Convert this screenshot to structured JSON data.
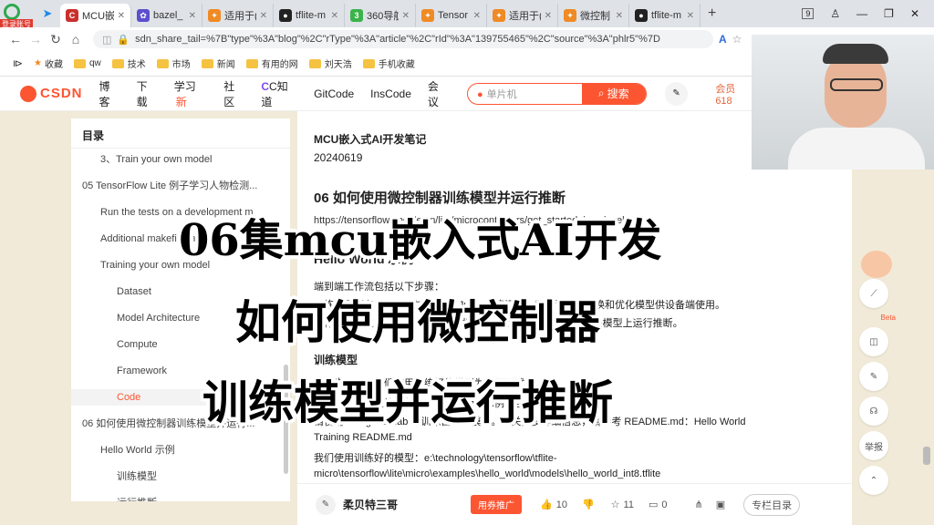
{
  "badge": "登录账号",
  "tabs": [
    {
      "label": "MCU嵌",
      "color": "#c9302c",
      "icon": "C",
      "active": true
    },
    {
      "label": "bazel_",
      "color": "#5b4fcf",
      "icon": "✿"
    },
    {
      "label": "适用于(",
      "color": "#f08a24",
      "icon": "✦"
    },
    {
      "label": "tflite-m",
      "color": "#222222",
      "icon": "●"
    },
    {
      "label": "360导航",
      "color": "#3bb34a",
      "icon": "3"
    },
    {
      "label": "Tensor",
      "color": "#f08a24",
      "icon": "✦"
    },
    {
      "label": "适用于(",
      "color": "#f08a24",
      "icon": "✦"
    },
    {
      "label": "微控制",
      "color": "#f08a24",
      "icon": "✦"
    },
    {
      "label": "tflite-m",
      "color": "#222222",
      "icon": "●"
    }
  ],
  "address": {
    "url": "sdn_share_tail=%7B\"type\"%3A\"blog\"%2C\"rType\"%3A\"article\"%2C\"rId\"%3A\"139755465\"%2C\"source\"%3A\"phlr5\"%7D"
  },
  "window": {
    "tab_count": "9"
  },
  "bookmarks": [
    "收藏",
    "qw",
    "技术",
    "市场",
    "新闻",
    "有用的网",
    "刘天浩",
    "手机收藏"
  ],
  "csdn": {
    "logo": "CSDN",
    "nav": [
      "博客",
      "下载",
      "学习",
      "社区",
      "C知道",
      "GitCode",
      "InsCode",
      "会议"
    ],
    "new_badge": "新",
    "search_placeholder": "单片机",
    "search_button": "搜索",
    "member": "会员618"
  },
  "toc": {
    "title": "目录",
    "items": [
      {
        "label": "3、Train your own model",
        "level": 1
      },
      {
        "label": "05 TensorFlow Lite 例子学习人物检测...",
        "level": 0
      },
      {
        "label": "Run the tests on a development m",
        "level": 1
      },
      {
        "label": "Additional makefile targets",
        "level": 1
      },
      {
        "label": "Training your own model",
        "level": 1
      },
      {
        "label": "Dataset",
        "level": 2
      },
      {
        "label": "Model Architecture",
        "level": 2
      },
      {
        "label": "Compute",
        "level": 2
      },
      {
        "label": "Framework",
        "level": 2
      },
      {
        "label": "Code",
        "level": 2,
        "active": true
      },
      {
        "label": "06 如何使用微控制器训练模型并运行...",
        "level": 0
      },
      {
        "label": "Hello World 示例",
        "level": 1
      },
      {
        "label": "训练模型",
        "level": 2
      },
      {
        "label": "运行推断",
        "level": 2
      }
    ]
  },
  "article": {
    "series": "MCU嵌入式AI开发笔记",
    "date": "20240619",
    "heading": "06 如何使用微控制器训练模型并运行推断",
    "link": "https://tensorflow.google.cn/lite/microcontrollers/get_started_low_level?hl=s",
    "section1": "Hello World 示例",
    "intro": "端到端工作流包括以下步骤：",
    "step1": "训练模型（在 Python 中）：一个 Jupyter 笔记本，用于训练、转换和优化模型供设备端使用。",
    "step2": "运行推断（在 C++ 17 中）：一个端到端单元测试，使用 C++ 库在模型上运行推断。",
    "section2": "训练模型",
    "p1": "这一步开始，我们使用训练好的模型为我们测试",
    "p2": "注意：本例跳过第一部分，我们将使用示例中包含的训练好的模型。",
    "p3": "请使用 Google Colab 来训练自己的模型。有关更多详细信息，请参考 README.md：Hello World",
    "p4": "Training README.md",
    "p5": "我们使用训练好的模型：e:\\technology\\tensorflow\\tflite-",
    "p6": "micro\\tensorflow\\lite\\micro\\examples\\hello_world\\models\\hello_world_int8.tflite"
  },
  "bottom": {
    "author": "柔贝特三哥",
    "promo": "用券推广",
    "likes": "10",
    "favs": "11",
    "comments": "0",
    "catalog": "专栏目录"
  },
  "rail": {
    "beta": "Beta",
    "report": "举报"
  },
  "overlay": {
    "line1": "06集mcu嵌入式AI开发",
    "line2": "如何使用微控制器",
    "line3": "训练模型并运行推断"
  }
}
